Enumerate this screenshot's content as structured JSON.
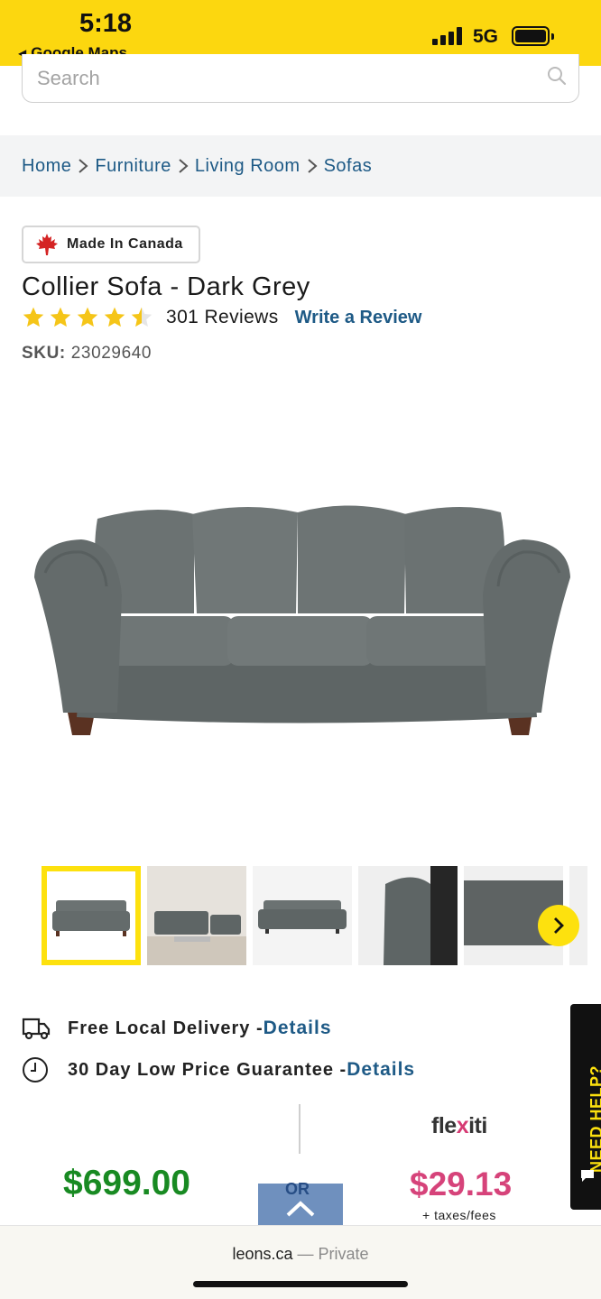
{
  "status_bar": {
    "time": "5:18",
    "back_app": "Google Maps",
    "network": "5G"
  },
  "search": {
    "placeholder": "Search"
  },
  "breadcrumb": [
    "Home",
    "Furniture",
    "Living Room",
    "Sofas"
  ],
  "badge": {
    "label": "Made In Canada"
  },
  "product": {
    "title": "Collier Sofa - Dark Grey",
    "rating": 4.5,
    "reviews": "301 Reviews",
    "write_review": "Write a Review",
    "sku_label": "SKU:",
    "sku_value": "23029640"
  },
  "delivery": {
    "free_local": "Free Local Delivery - ",
    "free_local_link": "Details",
    "guarantee": "30 Day Low Price Guarantee - ",
    "guarantee_link": "Details"
  },
  "help_tab": {
    "label": "NEED HELP?"
  },
  "pricing": {
    "price": "$699.00",
    "or": "OR",
    "financing_brand_a": "fle",
    "financing_brand_x": "x",
    "financing_brand_b": "iti",
    "financing_price": "$29.13",
    "taxes": "+ taxes/fees"
  },
  "browser": {
    "domain": "leons.ca",
    "mode": " — Private"
  },
  "colors": {
    "brand_yellow": "#fde10e",
    "link_blue": "#1e5a86",
    "price_green": "#188a22",
    "financing_pink": "#d6437a"
  }
}
